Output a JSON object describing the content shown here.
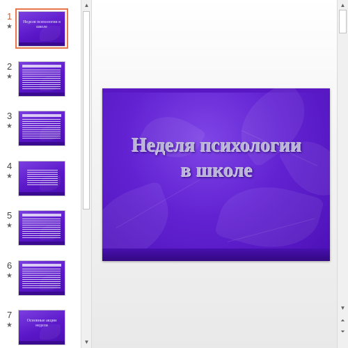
{
  "thumbnails": [
    {
      "number": "1",
      "has_animation": true,
      "selected": true,
      "kind": "title",
      "title": "Неделя психологии в школе"
    },
    {
      "number": "2",
      "has_animation": true,
      "selected": false,
      "kind": "text"
    },
    {
      "number": "3",
      "has_animation": true,
      "selected": false,
      "kind": "text"
    },
    {
      "number": "4",
      "has_animation": true,
      "selected": false,
      "kind": "italic"
    },
    {
      "number": "5",
      "has_animation": true,
      "selected": false,
      "kind": "list"
    },
    {
      "number": "6",
      "has_animation": true,
      "selected": false,
      "kind": "list"
    },
    {
      "number": "7",
      "has_animation": true,
      "selected": false,
      "kind": "title",
      "title": "Основные акции недели"
    }
  ],
  "animation_icon": "★",
  "main_slide": {
    "title": "Неделя психологии\nв школе"
  },
  "colors": {
    "slide_purple": "#6222d2",
    "selection_accent": "#e8764a",
    "title_text": "#b9b3d6"
  },
  "icons": {
    "scroll_up": "▲",
    "scroll_down": "▼",
    "prev_slide": "⏶",
    "next_slide": "⏷"
  }
}
